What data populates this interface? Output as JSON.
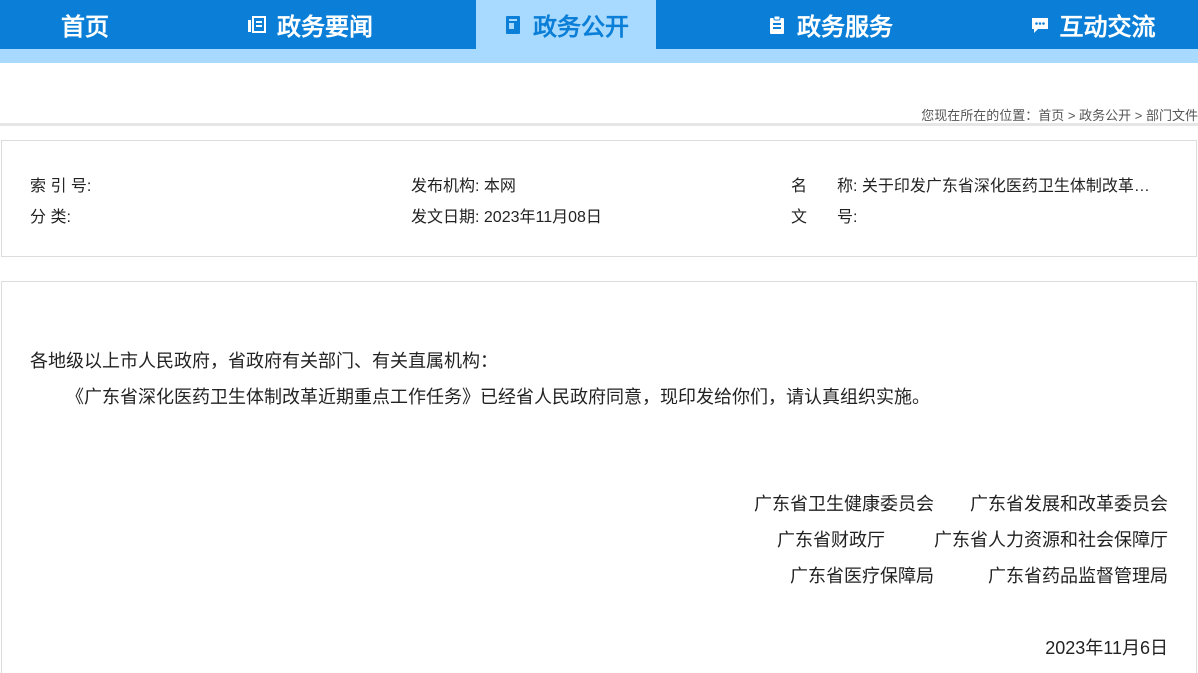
{
  "nav": {
    "items": [
      {
        "label": "首页"
      },
      {
        "label": "政务要闻"
      },
      {
        "label": "政务公开"
      },
      {
        "label": "政务服务"
      },
      {
        "label": "互动交流"
      }
    ]
  },
  "breadcrumb": {
    "prefix": "您现在所在的位置：",
    "items": [
      "首页",
      "政务公开",
      "部门文件"
    ],
    "sep": " > "
  },
  "meta": {
    "index_label": "索 引 号:",
    "index_value": "",
    "category_label": "分 类:",
    "category_value": "",
    "publisher_label": "发布机构:",
    "publisher_value": "本网",
    "date_label": "发文日期:",
    "date_value": "2023年11月08日",
    "name_label_a": "名",
    "name_label_b": "称:",
    "name_value": "关于印发广东省深化医药卫生体制改革近期重点工作任务的通知",
    "docno_label_a": "文",
    "docno_label_b": "号:",
    "docno_value": ""
  },
  "body": {
    "salutation": "各地级以上市人民政府，省政府有关部门、有关直属机构：",
    "paragraph": "《广东省深化医药卫生体制改革近期重点工作任务》已经省人民政府同意，现印发给你们，请认真组织实施。",
    "signers": [
      [
        "广东省卫生健康委员会",
        "广东省发展和改革委员会"
      ],
      [
        "广东省财政厅",
        "广东省人力资源和社会保障厅"
      ],
      [
        "广东省医疗保障局",
        "广东省药品监督管理局"
      ]
    ],
    "date": "2023年11月6日"
  },
  "colors": {
    "nav_bg": "#0b7fd7",
    "nav_active_bg": "#a8daff"
  }
}
